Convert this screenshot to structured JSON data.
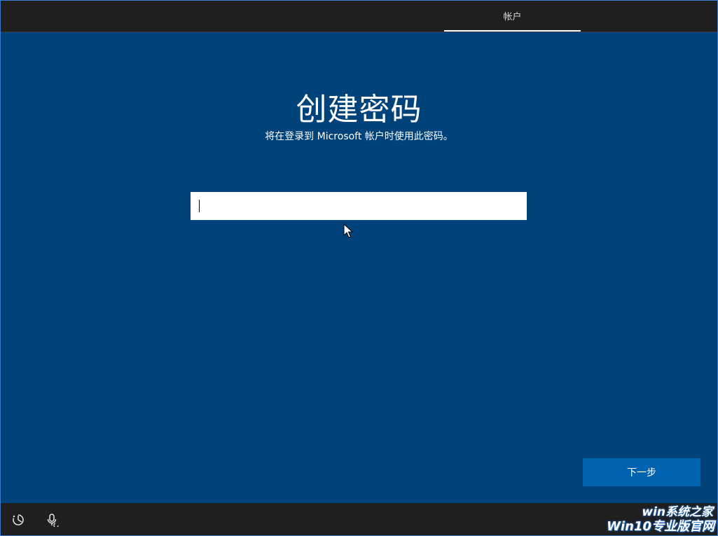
{
  "header": {
    "tabs": [
      {
        "label": "帐户",
        "active": true
      }
    ]
  },
  "main": {
    "title": "创建密码",
    "subtitle": "将在登录到 Microsoft 帐户时使用此密码。",
    "password_field": {
      "value": "",
      "placeholder": ""
    },
    "next_label": "下一步"
  },
  "bottom_bar": {
    "icons": [
      "ease-of-access-icon",
      "microphone-icon"
    ]
  },
  "watermark": {
    "line1": "win系统之家",
    "line2": "Win10专业版官网"
  },
  "colors": {
    "background": "#00427a",
    "bars": "#1f1f1f",
    "button": "#0063b1",
    "text": "#ffffff"
  }
}
